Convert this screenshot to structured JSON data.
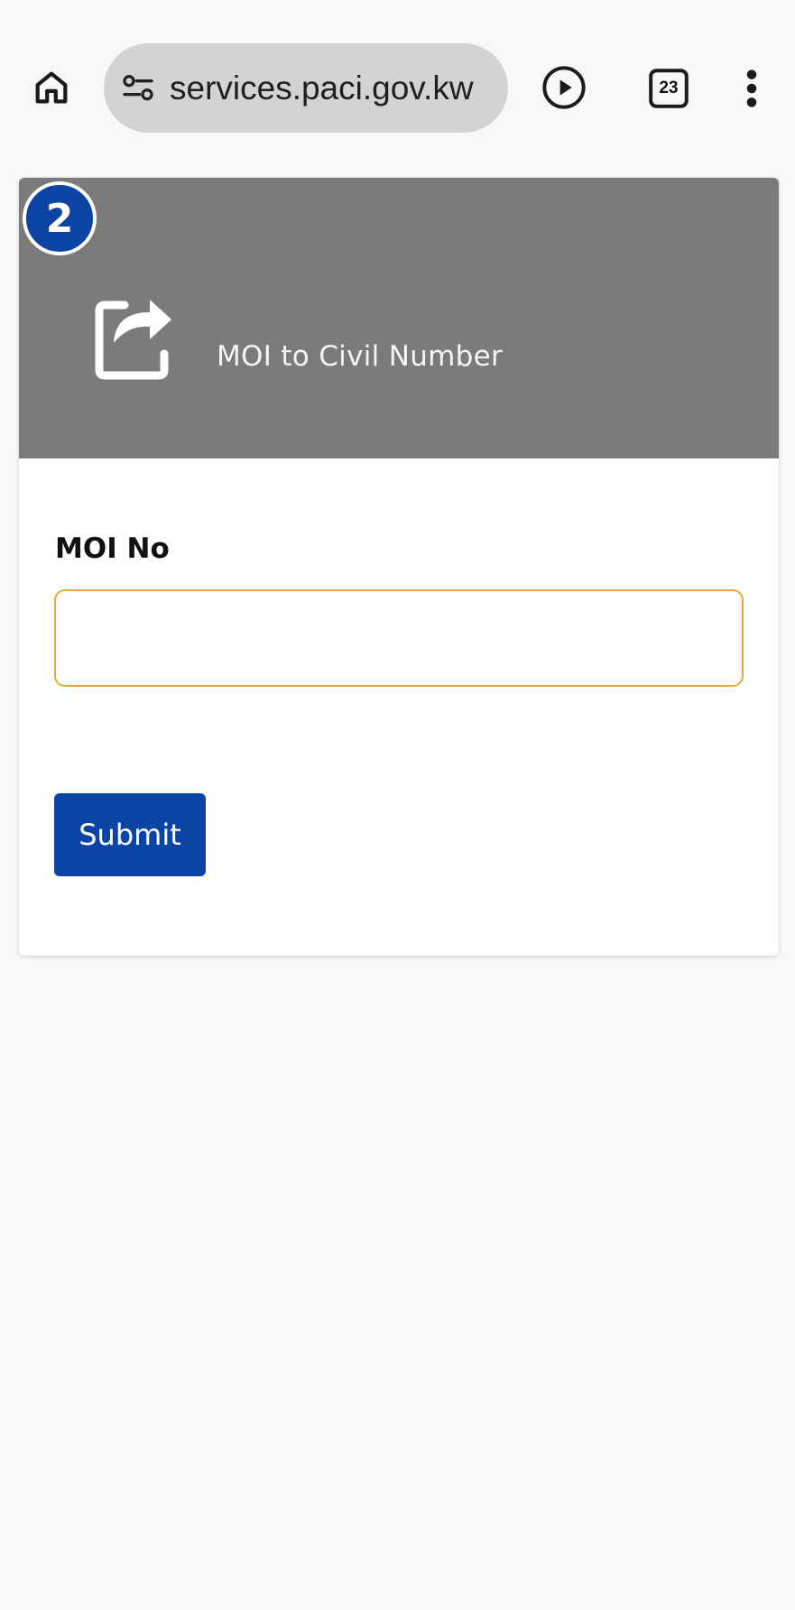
{
  "browser": {
    "url": "services.paci.gov.kw",
    "tab_count": "23",
    "icons": [
      "home-icon",
      "site-settings-icon",
      "play-icon",
      "tabs-icon",
      "more-vert-icon"
    ]
  },
  "step": {
    "number": "2"
  },
  "card": {
    "title": "MOI to Civil Number",
    "header_icon": "share-icon",
    "field_label": "MOI No",
    "input_value": "",
    "input_placeholder": "",
    "submit_label": "Submit"
  },
  "colors": {
    "header_bg": "#7b7b7b",
    "primary": "#0c44a6",
    "input_border": "#e8a93a",
    "url_bar_bg": "#d3d3d5"
  }
}
